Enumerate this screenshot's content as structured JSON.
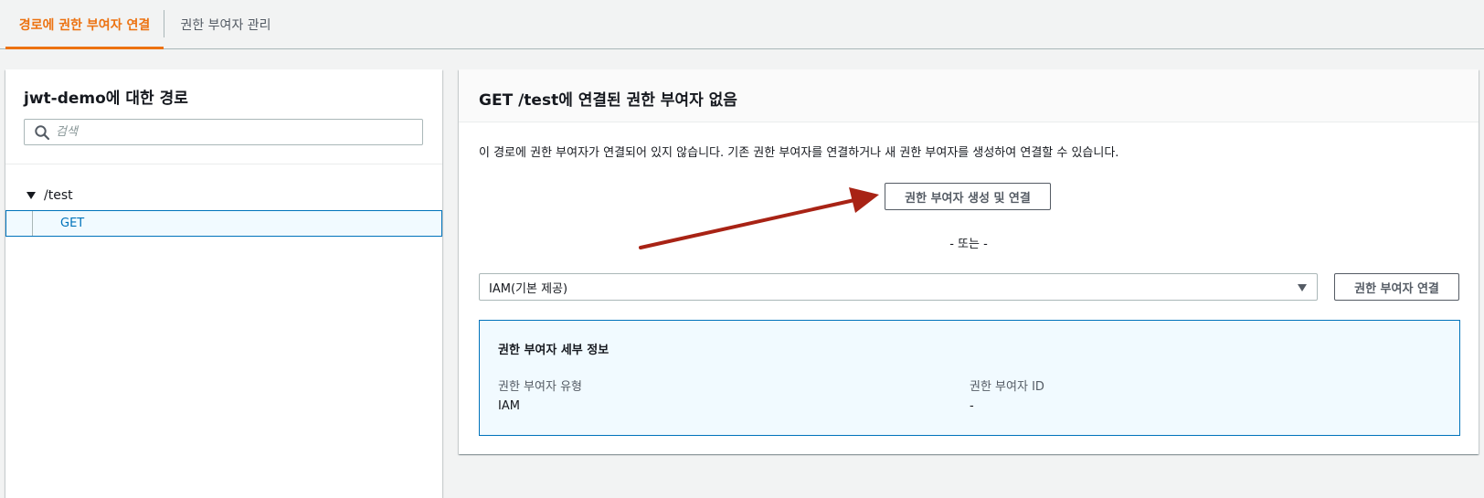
{
  "tabs": {
    "attach": "경로에 권한 부여자 연결",
    "manage": "권한 부여자 관리"
  },
  "sidebar": {
    "title": "jwt-demo에 대한 경로",
    "search_placeholder": "검색",
    "tree": {
      "root": "/test",
      "method": "GET"
    }
  },
  "main": {
    "title": "GET /test에 연결된 권한 부여자 없음",
    "description": "이 경로에 권한 부여자가 연결되어 있지 않습니다. 기존 권한 부여자를 연결하거나 새 권한 부여자를 생성하여 연결할 수 있습니다.",
    "create_button": "권한 부여자 생성 및 연결",
    "or_text": "- 또는 -",
    "select_value": "IAM(기본 제공)",
    "attach_button": "권한 부여자 연결",
    "details": {
      "title": "권한 부여자 세부 정보",
      "type_label": "권한 부여자 유형",
      "type_value": "IAM",
      "id_label": "권한 부여자 ID",
      "id_value": "-"
    }
  },
  "colors": {
    "accent": "#ec7211",
    "link": "#0073bb",
    "annotation_arrow": "#a82315"
  }
}
